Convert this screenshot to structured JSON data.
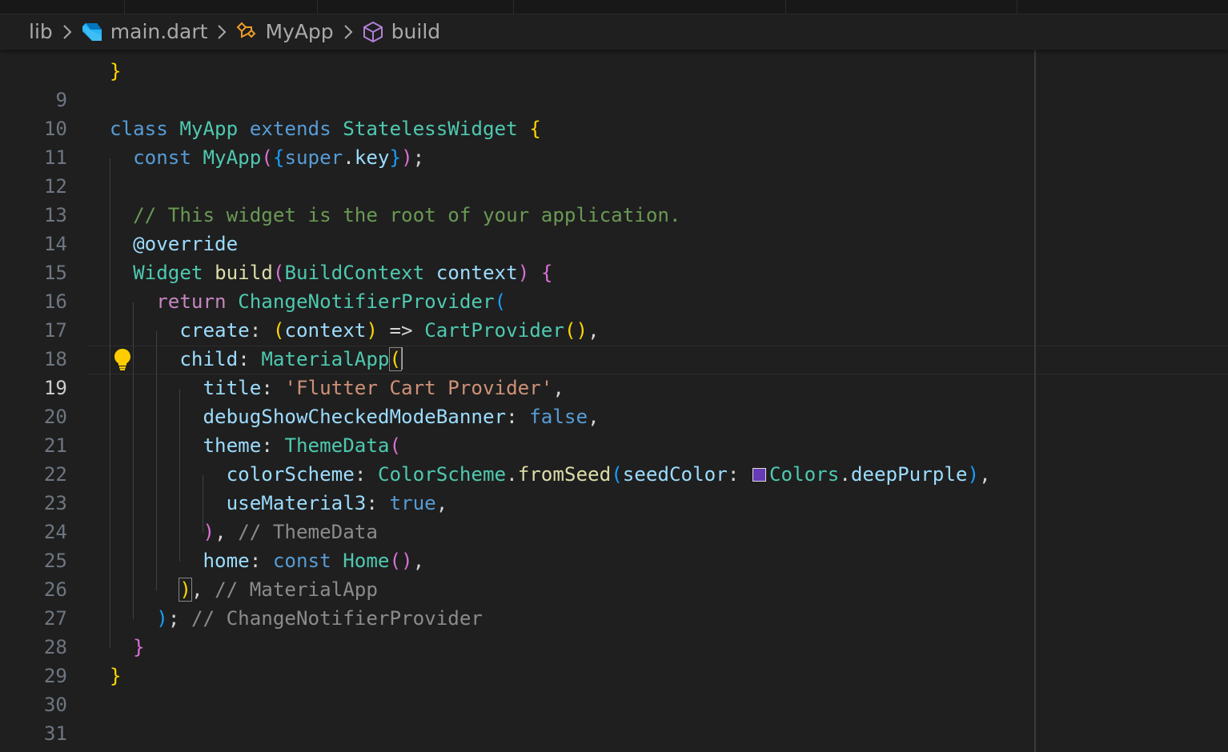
{
  "breadcrumb": {
    "folder": "lib",
    "file": "main.dart",
    "class_name": "MyApp",
    "method": "build",
    "icons": [
      "dart-file-icon",
      "class-symbol-icon",
      "method-symbol-icon"
    ]
  },
  "editor": {
    "active_line": "19",
    "ruler_visible": true,
    "seed_color_swatch": "#673ab7",
    "lightbulb_color": "#ffcc00",
    "line_numbers": [
      "9",
      "10",
      "11",
      "12",
      "13",
      "14",
      "15",
      "16",
      "17",
      "18",
      "19",
      "20",
      "21",
      "22",
      "23",
      "24",
      "25",
      "26",
      "27",
      "28",
      "29",
      "30",
      "31"
    ],
    "tokens": {
      "l9_brace": "}",
      "l11_class": "class",
      "l11_name": "MyApp",
      "l11_extends": "extends",
      "l11_base": "StatelessWidget",
      "l11_open": "{",
      "l12_const": "const",
      "l12_ctor": "MyApp",
      "l12_paren_open": "(",
      "l12_brace_open": "{",
      "l12_super": "super",
      "l12_dot": ".",
      "l12_key": "key",
      "l12_brace_close": "}",
      "l12_paren_close": ")",
      "l12_semi": ";",
      "l14_comment": "// This widget is the root of your application.",
      "l15_annotation": "@override",
      "l16_type": "Widget",
      "l16_fn": "build",
      "l16_paren_open": "(",
      "l16_param_type": "BuildContext",
      "l16_param": "context",
      "l16_paren_close": ")",
      "l16_brace": "{",
      "l17_return": "return",
      "l17_class": "ChangeNotifierProvider",
      "l17_paren": "(",
      "l18_prop": "create",
      "l18_colon": ":",
      "l18_paren_open": "(",
      "l18_param": "context",
      "l18_paren_close": ")",
      "l18_arrow": "=>",
      "l18_class": "CartProvider",
      "l18_call": "()",
      "l18_comma": ",",
      "l19_prop": "child",
      "l19_colon": ":",
      "l19_class": "MaterialApp",
      "l19_paren": "(",
      "l20_prop": "title",
      "l20_colon": ":",
      "l20_string": "'Flutter Cart Provider'",
      "l20_comma": ",",
      "l21_prop": "debugShowCheckedModeBanner",
      "l21_colon": ":",
      "l21_value": "false",
      "l21_comma": ",",
      "l22_prop": "theme",
      "l22_colon": ":",
      "l22_class": "ThemeData",
      "l22_paren": "(",
      "l23_prop": "colorScheme",
      "l23_colon": ":",
      "l23_class": "ColorScheme",
      "l23_dot": ".",
      "l23_method": "fromSeed",
      "l23_paren_open": "(",
      "l23_named": "seedColor",
      "l23_colon2": ":",
      "l23_colors": "Colors",
      "l23_dot2": ".",
      "l23_member": "deepPurple",
      "l23_paren_close": ")",
      "l23_comma": ",",
      "l24_prop": "useMaterial3",
      "l24_colon": ":",
      "l24_value": "true",
      "l24_comma": ",",
      "l25_paren": ")",
      "l25_comma": ",",
      "l25_hint": "// ThemeData",
      "l26_prop": "home",
      "l26_colon": ":",
      "l26_const": "const",
      "l26_class": "Home",
      "l26_call": "()",
      "l26_comma": ",",
      "l27_paren": ")",
      "l27_comma": ",",
      "l27_hint": "// MaterialApp",
      "l28_paren": ")",
      "l28_semi": ";",
      "l28_hint": "// ChangeNotifierProvider",
      "l29_brace": "}",
      "l30_brace": "}"
    }
  }
}
